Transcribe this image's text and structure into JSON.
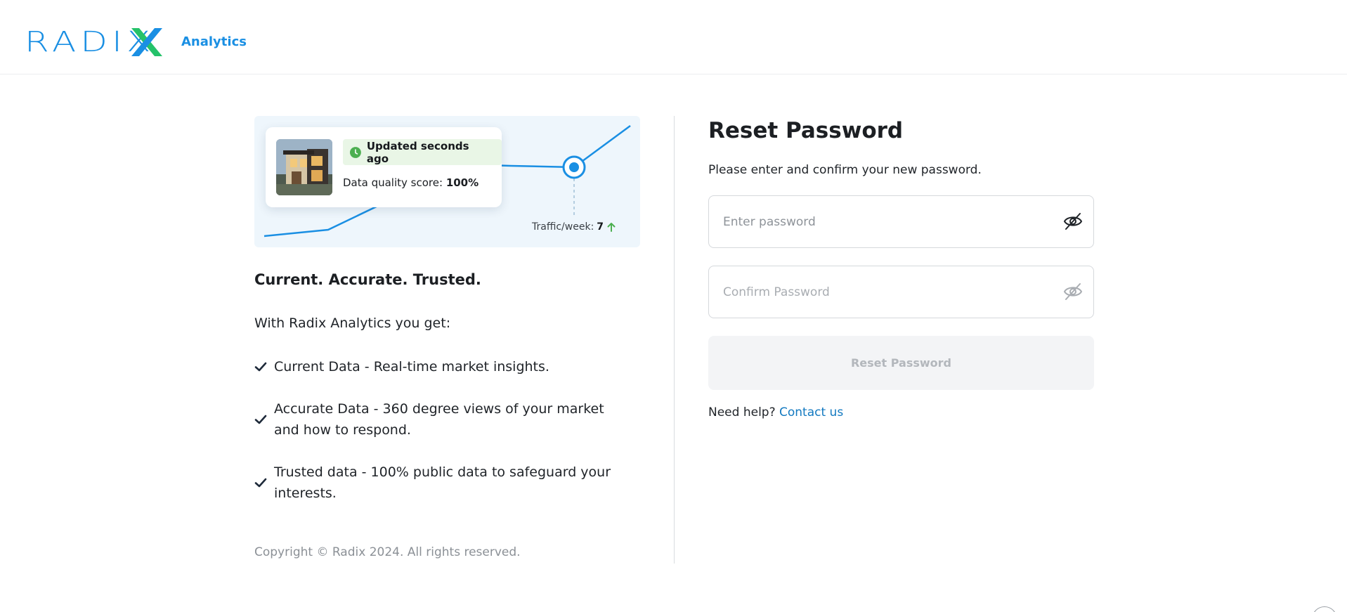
{
  "header": {
    "logo_text": "RADIX",
    "brand_sub": "Analytics"
  },
  "hero": {
    "badge_text": "Updated seconds ago",
    "score_label": "Data quality score:",
    "score_value": "100%",
    "traffic_label": "Traffic/week:",
    "traffic_value": "7",
    "colors": {
      "line": "#1a8fe3",
      "badge_bg": "#e9f6e6",
      "clock": "#4caf50",
      "arrow": "#4caf50"
    }
  },
  "marketing": {
    "tagline": "Current. Accurate. Trusted.",
    "intro": "With Radix Analytics you get:",
    "benefits": [
      {
        "text": "Current Data - Real-time market insights."
      },
      {
        "text": "Accurate Data - 360 degree views of your market and how to respond."
      },
      {
        "text": "Trusted data - 100% public data to safeguard your interests."
      }
    ],
    "copyright": "Copyright © Radix 2024. All rights reserved."
  },
  "form": {
    "title": "Reset Password",
    "subtitle": "Please enter and confirm your new password.",
    "password_placeholder": "Enter password",
    "confirm_placeholder": "Confirm Password",
    "password_value": "",
    "confirm_value": "",
    "submit_label": "Reset Password",
    "submit_state": "disabled",
    "help_text": "Need help?",
    "help_link": "Contact us"
  },
  "theme": {
    "accent": "#1a8fe3",
    "link": "#1279c0",
    "check": "#1e2a3a"
  }
}
